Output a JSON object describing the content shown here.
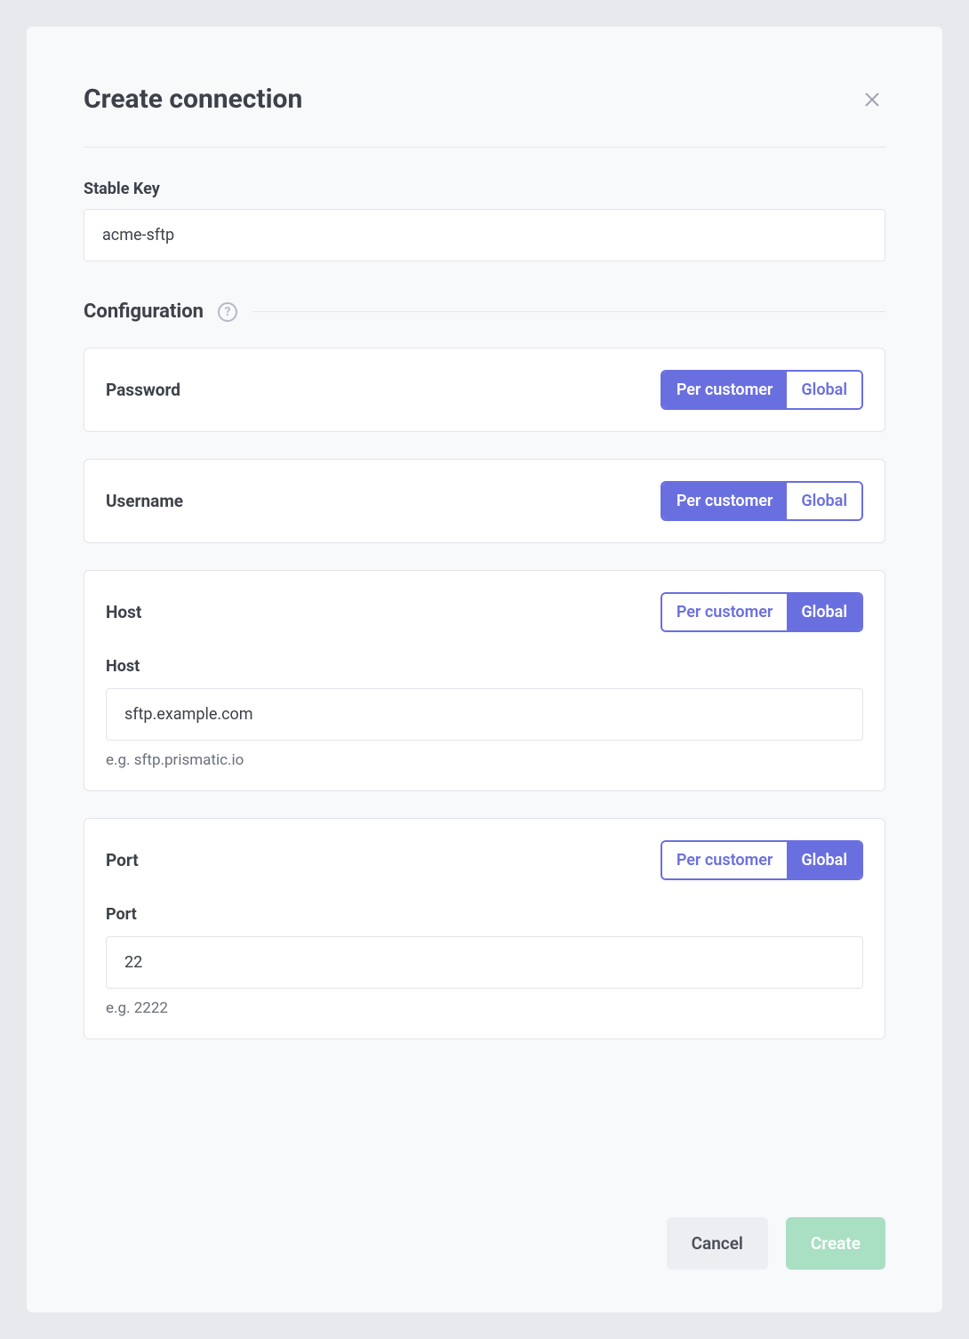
{
  "modal": {
    "title": "Create connection",
    "stableKey": {
      "label": "Stable Key",
      "value": "acme-sftp"
    },
    "configSection": {
      "title": "Configuration"
    },
    "toggle": {
      "perCustomer": "Per customer",
      "global": "Global"
    },
    "fields": {
      "password": {
        "name": "Password",
        "scope": "per_customer"
      },
      "username": {
        "name": "Username",
        "scope": "per_customer"
      },
      "host": {
        "name": "Host",
        "scope": "global",
        "sub": {
          "label": "Host",
          "value": "sftp.example.com",
          "hint": "e.g. sftp.prismatic.io"
        }
      },
      "port": {
        "name": "Port",
        "scope": "global",
        "sub": {
          "label": "Port",
          "value": "22",
          "hint": "e.g. 2222"
        }
      }
    },
    "footer": {
      "cancel": "Cancel",
      "create": "Create"
    }
  }
}
